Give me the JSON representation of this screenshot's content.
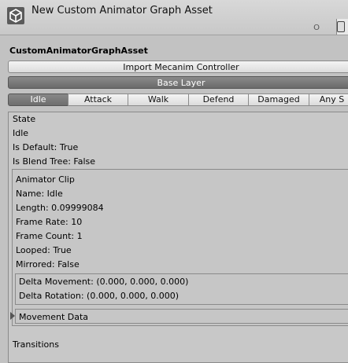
{
  "window": {
    "title": "New Custom Animator Graph Asset",
    "subtitle": "O"
  },
  "asset": {
    "name": "CustomAnimatorGraphAsset",
    "import_button": "Import Mecanim Controller",
    "layer_button": "Base Layer"
  },
  "tabs": [
    "Idle",
    "Attack",
    "Walk",
    "Defend",
    "Damaged",
    "Any S"
  ],
  "state": {
    "header": "State",
    "name": "Idle",
    "is_default": "Is Default: True",
    "is_blend_tree": "Is Blend Tree: False"
  },
  "clip": {
    "header": "Animator Clip",
    "name": "Name: Idle",
    "length": "Length: 0.09999084",
    "frame_rate": "Frame Rate: 10",
    "frame_count": "Frame Count: 1",
    "looped": "Looped: True",
    "mirrored": "Mirrored: False"
  },
  "delta": {
    "movement": "Delta Movement: (0.000, 0.000, 0.000)",
    "rotation": "Delta Rotation: (0.000, 0.000, 0.000)"
  },
  "movement_data": {
    "label": "Movement Data"
  },
  "transitions": {
    "label": "Transitions"
  }
}
